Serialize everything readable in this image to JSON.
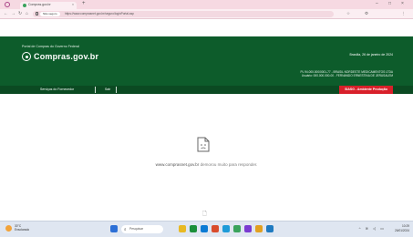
{
  "browser": {
    "tab_title": "Compras.gov.br",
    "tab_close": "×",
    "new_tab": "+",
    "window_controls": [
      "–",
      "□",
      "×"
    ],
    "nav": [
      "←",
      "→",
      "↻",
      "⌂"
    ],
    "chip_label": "Não seguro",
    "url": "https://www.comprasnet.gov.br/seguro/loginPortal.asp",
    "ext_icons": [
      "☆",
      "⚙",
      "⋮"
    ]
  },
  "site": {
    "org_name": "Portal de Compras do Governo Federal",
    "logo_text": "Compras.gov.br",
    "date": "Brasília, 26 de janeiro de 2024",
    "user_line1": "PL 94.000.000/0001-77 - BRASIL NORDESTE MEDICAMENTOS LTDA",
    "user_line2": "Usuário: 000.000.000-00 - FERNANDO ERNESTINA DE JERUSALEM",
    "menu": [
      "Serviços do Fornecedor",
      "Sair"
    ],
    "environment_badge": "SIASG - Ambiente Produção"
  },
  "error": {
    "host": "www.comprasnet.gov.br",
    "message": "demorou muito para responder."
  },
  "taskbar": {
    "weather_temp": "30°C",
    "weather_desc": "Ensolarado",
    "search_placeholder": "Pesquisar",
    "search_icon_glyph": "⌕",
    "tray_time": "10:29",
    "tray_date": "26/01/2024",
    "tray_glyphs": "^ ≋ ◁ ▭",
    "app_colors": [
      "#2c6fd6",
      "#e8b923",
      "#1b8f3a",
      "#0a7ad4",
      "#d94c2c",
      "#1e9bd8",
      "#3aa35c",
      "#7a3bd1",
      "#e2a020",
      "#1f7ac0"
    ]
  }
}
